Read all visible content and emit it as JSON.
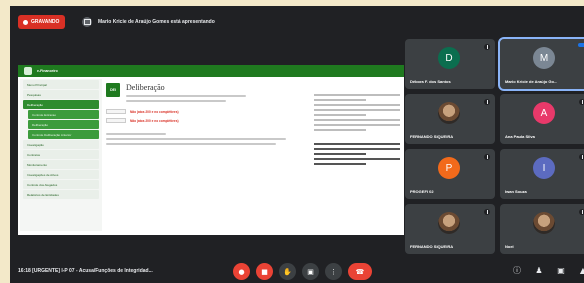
{
  "recording": {
    "label": "GRAVANDO"
  },
  "presenter": {
    "text": "Mario Kricie de Araújo Gomes está apresentando"
  },
  "shared_screen": {
    "top_title": "e-Financeiro",
    "doc_icon_text": "DEI",
    "doc_title": "Deliberação",
    "status_texts": [
      "Não (atos 200 e no complétiees)",
      "Não (atos 200 e no complétiees)"
    ],
    "sidebar": [
      {
        "label": "Menu Principal"
      },
      {
        "label": "Pesquisas"
      },
      {
        "label": "Deliberação",
        "highlight": true
      },
      {
        "label": "Controle Extracao",
        "sub": true
      },
      {
        "label": "Deliberação",
        "sub": true
      },
      {
        "label": "Controle Deliberação Anterior",
        "sub": true
      },
      {
        "label": "Investigação"
      },
      {
        "label": "Contratos"
      },
      {
        "label": "Monitoramento"
      },
      {
        "label": "Investigações de Ativos"
      },
      {
        "label": "Controle dos Alegados"
      },
      {
        "label": "Relatórios de Entidades"
      }
    ]
  },
  "participants": [
    {
      "initial": "D",
      "name": "Débora F. dos Santos",
      "color": "#0b6e4f"
    },
    {
      "initial": "M",
      "name": "Mario Kricie de Araújo Go...",
      "color": "#7b8794",
      "active": true
    },
    {
      "initial": "",
      "name": "FERNANDO SIQUEIRA",
      "photo": true
    },
    {
      "initial": "A",
      "name": "Ana Paula Silva",
      "color": "#e8396a"
    },
    {
      "initial": "P",
      "name": "PROGEFI 02",
      "color": "#f26a1b"
    },
    {
      "initial": "I",
      "name": "Iwan Souza",
      "color": "#5c6bc0"
    },
    {
      "initial": "",
      "name": "FERNANDO SIQUEIRA",
      "photo": true
    },
    {
      "initial": "",
      "name": "Noel",
      "photo": true
    }
  ],
  "bottom_bar": {
    "meeting_code": "16:18   [URGENTE] I-P 07 - Acusa/Funções de Integridad..."
  },
  "colors": {
    "background": "#202124",
    "recording": "#d93025",
    "end_call": "#ea4335"
  }
}
